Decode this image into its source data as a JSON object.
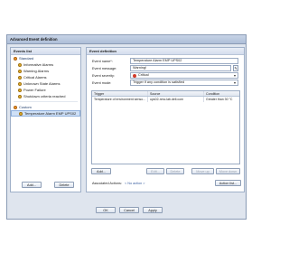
{
  "dialog": {
    "title": "Advanced Event definition"
  },
  "events_list": {
    "title": "Events list",
    "standard_group": "Standard",
    "items": [
      {
        "label": "Informative Alarms"
      },
      {
        "label": "Warning Alarms"
      },
      {
        "label": "Critical Alarms"
      },
      {
        "label": "Unknown State Alarms"
      },
      {
        "label": "Power Failure"
      },
      {
        "label": "Shutdown criteria reached"
      }
    ],
    "custom_group": "Custom",
    "custom_items": [
      {
        "label": "Temperature Alarm EMP UPS02"
      }
    ],
    "add_label": "Add...",
    "delete_label": "Delete"
  },
  "event_definition": {
    "title": "Event definition",
    "name_label": "Event name*:",
    "name_value": "Temperature Alarm EMP UPS02",
    "message_label": "Event message:",
    "message_value": "Warning!",
    "severity_label": "Event severity:",
    "severity_value": "Critical",
    "mode_label": "Event mode:",
    "mode_value": "Trigger if any condition is satisfied",
    "table": {
      "headers": [
        "Trigger",
        "Source",
        "Condition"
      ],
      "rows": [
        [
          "Temperature of environment senso...",
          "ups02-nmc.lab.dell.com",
          "Greater than 30 °C"
        ]
      ]
    },
    "buttons": {
      "add": "Add...",
      "edit": "Edit...",
      "delete": "Delete",
      "move_up": "Move up",
      "move_down": "Move down"
    },
    "associated_label": "Associated Actions:",
    "associated_value": "< No action >",
    "action_list_label": "Action list..."
  },
  "footer": {
    "ok": "OK",
    "cancel": "Cancel",
    "apply": "Apply"
  }
}
